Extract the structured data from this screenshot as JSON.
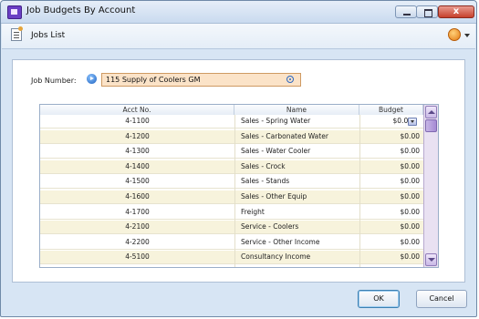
{
  "window": {
    "title": "Job Budgets By Account",
    "close_glyph": "x"
  },
  "toolbar": {
    "jobs_list_label": "Jobs List"
  },
  "form": {
    "job_number_label": "Job Number:",
    "job_number_value": "115 Supply of Coolers GM"
  },
  "table": {
    "headers": {
      "acct": "Acct No.",
      "name": "Name",
      "budget": "Budget"
    },
    "rows": [
      {
        "acct": "4-1100",
        "name": "Sales - Spring Water",
        "budget": "$0.00"
      },
      {
        "acct": "4-1200",
        "name": "Sales - Carbonated Water",
        "budget": "$0.00"
      },
      {
        "acct": "4-1300",
        "name": "Sales - Water Cooler",
        "budget": "$0.00"
      },
      {
        "acct": "4-1400",
        "name": "Sales - Crock",
        "budget": "$0.00"
      },
      {
        "acct": "4-1500",
        "name": "Sales - Stands",
        "budget": "$0.00"
      },
      {
        "acct": "4-1600",
        "name": "Sales - Other Equip",
        "budget": "$0.00"
      },
      {
        "acct": "4-1700",
        "name": "Freight",
        "budget": "$0.00"
      },
      {
        "acct": "4-2100",
        "name": "Service - Coolers",
        "budget": "$0.00"
      },
      {
        "acct": "4-2200",
        "name": "Service - Other Income",
        "budget": "$0.00"
      },
      {
        "acct": "4-5100",
        "name": "Consultancy Income",
        "budget": "$0.00"
      }
    ]
  },
  "buttons": {
    "ok": "OK",
    "cancel": "Cancel"
  },
  "icons": [
    "app-icon",
    "jobs-list-icon",
    "help-icon",
    "arrow-icon",
    "search-icon",
    "calculator-icon"
  ],
  "colors": {
    "input_bg": "#fbe3c8",
    "alt_row": "#f7f3dc",
    "scrollbar": "#a58ad4"
  }
}
